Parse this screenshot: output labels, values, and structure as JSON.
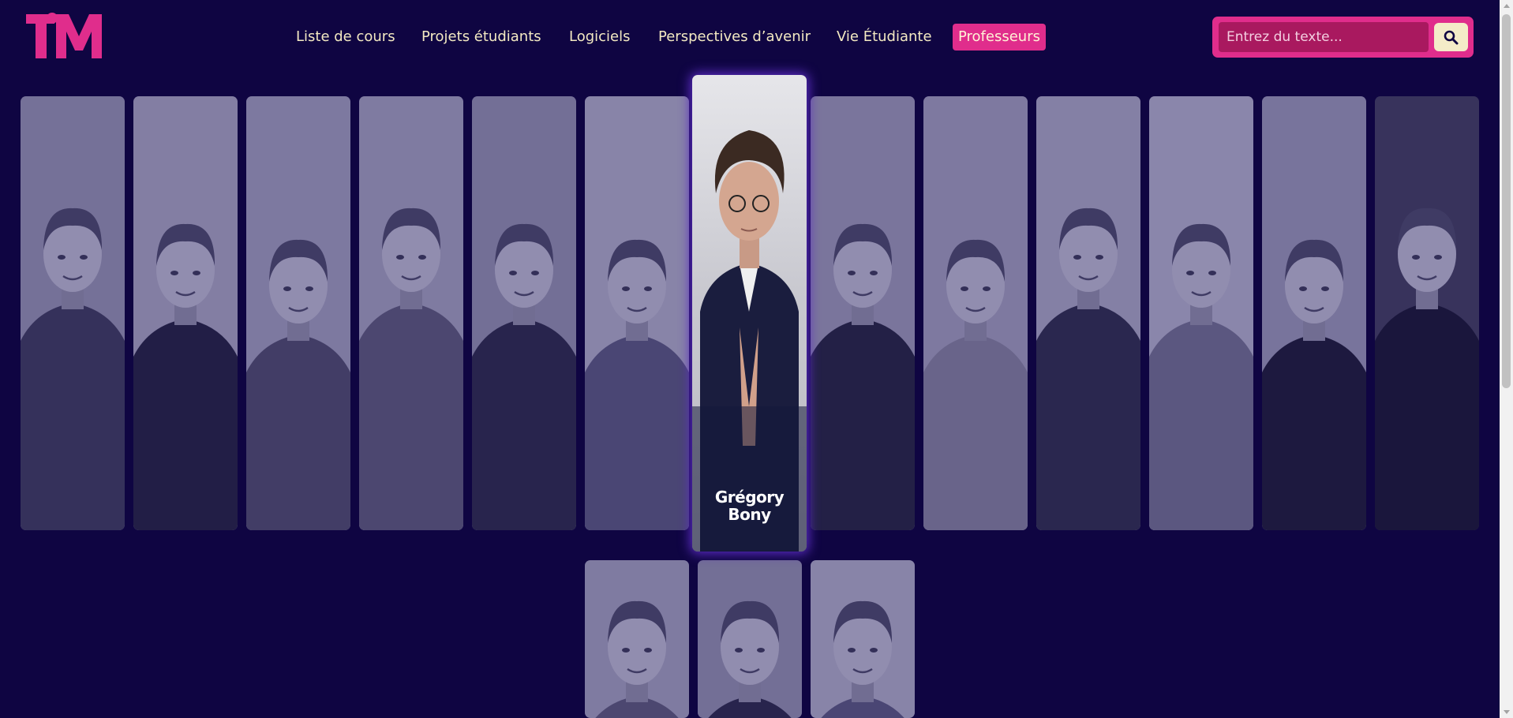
{
  "site": {
    "logo_text": "TIM",
    "brand_color": "#e02d8c",
    "background": "#0f0542"
  },
  "nav": {
    "items": [
      {
        "label": "Liste de cours"
      },
      {
        "label": "Projets étudiants"
      },
      {
        "label": "Logiciels"
      },
      {
        "label": "Perspectives d’avenir"
      },
      {
        "label": "Vie Étudiante"
      },
      {
        "label": "Professeurs",
        "active": true
      }
    ]
  },
  "search": {
    "placeholder": "Entrez du texte...",
    "button_icon": "search-icon"
  },
  "professors": {
    "featured_name": "Grégory\nBony",
    "row1_count": 13,
    "row2_count": 3
  }
}
